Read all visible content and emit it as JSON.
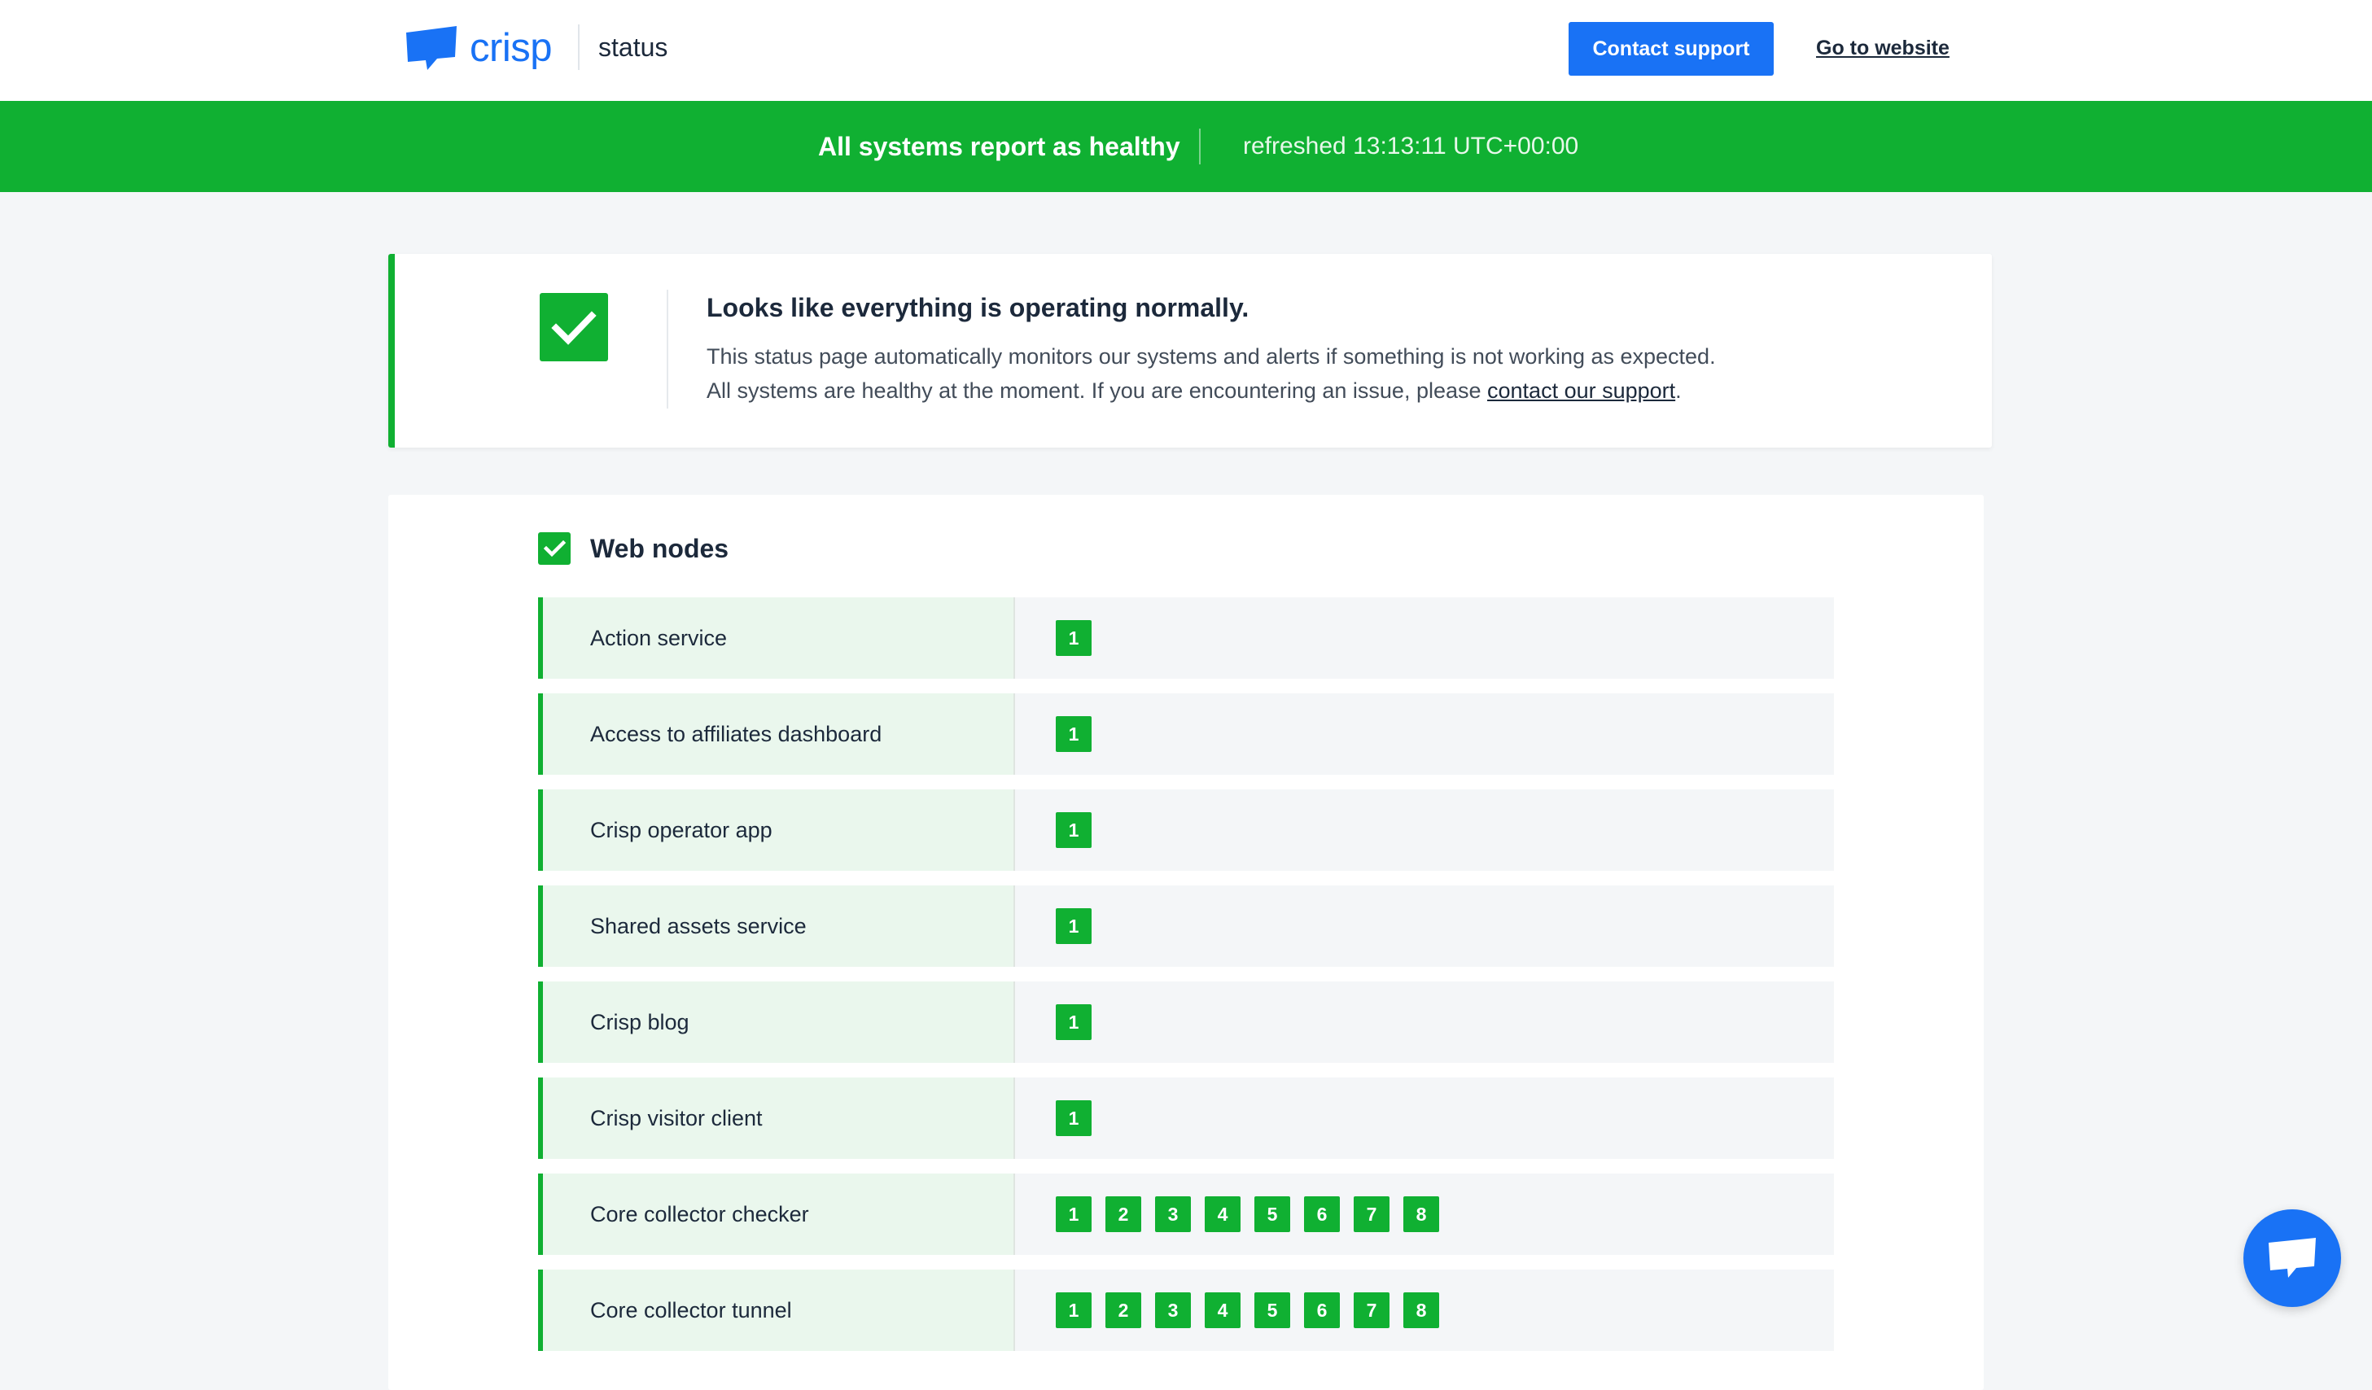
{
  "header": {
    "logo_text": "crisp",
    "logo_sub": "status",
    "support_label": "Contact support",
    "website_label": "Go to website"
  },
  "banner": {
    "status_text": "All systems report as healthy",
    "refreshed_text": "refreshed 13:13:11 UTC+00:00",
    "color": "#10b032"
  },
  "summary": {
    "title": "Looks like everything is operating normally.",
    "line1": "This status page automatically monitors our systems and alerts if something is not working as expected.",
    "line2_prefix": "All systems are healthy at the moment. If you are encountering an issue, please ",
    "line2_link": "contact our support",
    "line2_suffix": "."
  },
  "section": {
    "title": "Web nodes",
    "services": [
      {
        "name": "Action service",
        "nodes": [
          "1"
        ]
      },
      {
        "name": "Access to affiliates dashboard",
        "nodes": [
          "1"
        ]
      },
      {
        "name": "Crisp operator app",
        "nodes": [
          "1"
        ]
      },
      {
        "name": "Shared assets service",
        "nodes": [
          "1"
        ]
      },
      {
        "name": "Crisp blog",
        "nodes": [
          "1"
        ]
      },
      {
        "name": "Crisp visitor client",
        "nodes": [
          "1"
        ]
      },
      {
        "name": "Core collector checker",
        "nodes": [
          "1",
          "2",
          "3",
          "4",
          "5",
          "6",
          "7",
          "8"
        ]
      },
      {
        "name": "Core collector tunnel",
        "nodes": [
          "1",
          "2",
          "3",
          "4",
          "5",
          "6",
          "7",
          "8"
        ]
      }
    ]
  },
  "icons": {
    "logo": "crisp-chat-bubble-icon",
    "status": "checkmark-icon",
    "chat": "chat-bubble-icon"
  },
  "colors": {
    "brand": "#1972f5",
    "healthy": "#10b032",
    "healthy_light": "#eaf7ed"
  }
}
